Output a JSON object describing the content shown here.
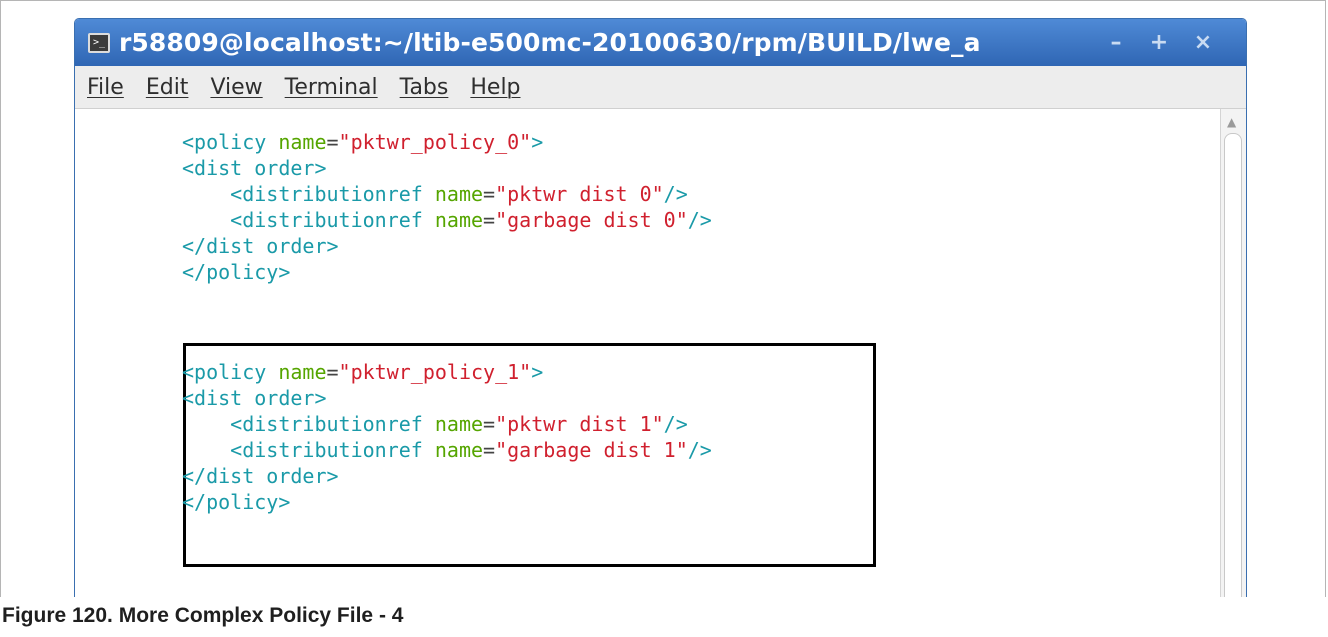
{
  "window": {
    "title": "r58809@localhost:~/ltib-e500mc-20100630/rpm/BUILD/lwe_a",
    "terminal_icon": "terminal-icon",
    "buttons": {
      "minimize": "–",
      "maximize": "+",
      "close": "×"
    }
  },
  "menu": [
    "File",
    "Edit",
    "View",
    "Terminal",
    "Tabs",
    "Help"
  ],
  "code_blocks": [
    {
      "policy_open": "<policy ",
      "policy_attr": "name",
      "eq": "=",
      "policy_name": "\"pktwr_policy_0\"",
      "policy_close_bracket": ">",
      "dist_order_open": "<dist order>",
      "dref_open": "<distributionref ",
      "dref_attr": "name",
      "dref1_value": "\"pktwr dist 0\"",
      "dref2_value": "\"garbage dist 0\"",
      "dref_close": "/>",
      "dist_order_close": "</dist order>",
      "policy_end": "</policy>"
    },
    {
      "policy_open": "<policy ",
      "policy_attr": "name",
      "eq": "=",
      "policy_name": "\"pktwr_policy_1\"",
      "policy_close_bracket": ">",
      "dist_order_open": "<dist order>",
      "dref_open": "<distributionref ",
      "dref_attr": "name",
      "dref1_value": "\"pktwr dist 1\"",
      "dref2_value": "\"garbage dist 1\"",
      "dref_close": "/>",
      "dist_order_close": "</dist order>",
      "policy_end": "</policy>"
    }
  ],
  "caption": "Figure 120.  More Complex Policy File - 4",
  "colors": {
    "titlebar": "#3b75c4",
    "tag": "#1a9aa8",
    "attr": "#55a500",
    "value": "#d0202e"
  }
}
